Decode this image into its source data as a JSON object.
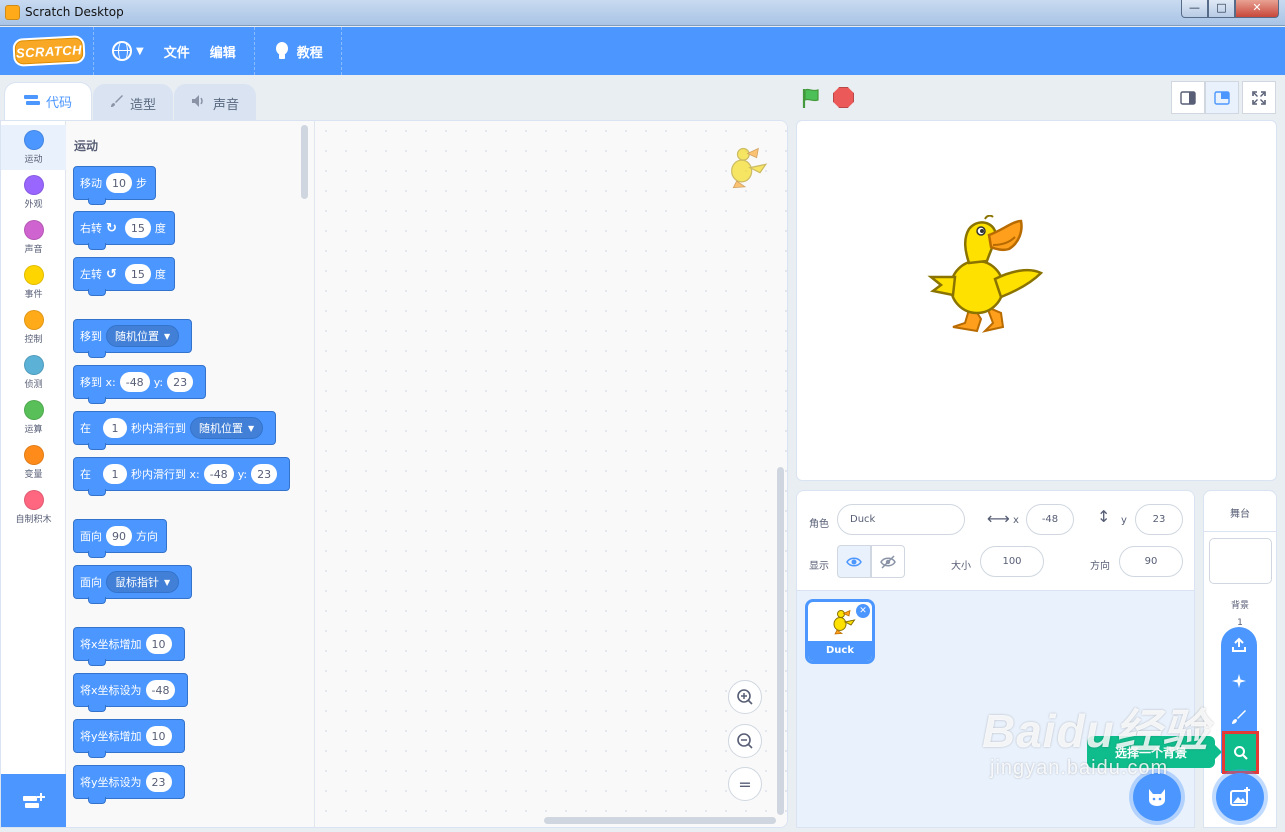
{
  "window": {
    "title": "Scratch Desktop",
    "controls": [
      "—",
      "□",
      "✕"
    ]
  },
  "menubar": {
    "logo": "SCRATCH",
    "file": "文件",
    "edit": "编辑",
    "tutorials": "教程"
  },
  "tabs": {
    "code": "代码",
    "costumes": "造型",
    "sounds": "声音"
  },
  "categories": [
    {
      "label": "运动",
      "color": "#4c97ff"
    },
    {
      "label": "外观",
      "color": "#9966ff"
    },
    {
      "label": "声音",
      "color": "#cf63cf"
    },
    {
      "label": "事件",
      "color": "#ffd500"
    },
    {
      "label": "控制",
      "color": "#ffab19"
    },
    {
      "label": "侦测",
      "color": "#5cb1d6"
    },
    {
      "label": "运算",
      "color": "#59c059"
    },
    {
      "label": "变量",
      "color": "#ff8c1a"
    },
    {
      "label": "自制积木",
      "color": "#ff6680"
    }
  ],
  "palette": {
    "title": "运动",
    "move": {
      "a": "移动",
      "n": "10",
      "b": "步"
    },
    "turn_right": {
      "a": "右转",
      "n": "15",
      "b": "度"
    },
    "turn_left": {
      "a": "左转",
      "n": "15",
      "b": "度"
    },
    "goto": {
      "a": "移到",
      "d": "随机位置"
    },
    "goto_xy": {
      "a": "移到 x:",
      "x": "-48",
      "yl": "y:",
      "y": "23"
    },
    "glide": {
      "a": "在",
      "n": "1",
      "b": "秒内滑行到",
      "d": "随机位置"
    },
    "glide_xy": {
      "a": "在",
      "n": "1",
      "b": "秒内滑行到 x:",
      "x": "-48",
      "yl": "y:",
      "y": "23"
    },
    "point_dir": {
      "a": "面向",
      "n": "90",
      "b": "方向"
    },
    "point_towards": {
      "a": "面向",
      "d": "鼠标指针"
    },
    "change_x": {
      "a": "将x坐标增加",
      "n": "10"
    },
    "set_x": {
      "a": "将x坐标设为",
      "n": "-48"
    },
    "change_y": {
      "a": "将y坐标增加",
      "n": "10"
    },
    "set_y": {
      "a": "将y坐标设为",
      "n": "23"
    }
  },
  "zoom": {
    "in": "+",
    "out": "−",
    "reset": "="
  },
  "sprite_info": {
    "sprite_label": "角色",
    "sprite_name": "Duck",
    "x_label": "x",
    "x": "-48",
    "y_label": "y",
    "y": "23",
    "show_label": "显示",
    "size_label": "大小",
    "size": "100",
    "direction_label": "方向",
    "direction": "90"
  },
  "sprites": [
    {
      "name": "Duck"
    }
  ],
  "stage_pane": {
    "title": "舞台",
    "backdrops_label": "背景",
    "backdrops_count": "1"
  },
  "tooltip": "选择一个背景",
  "watermark": {
    "brand": "Baidu经验",
    "url": "jingyan.baidu.com"
  }
}
